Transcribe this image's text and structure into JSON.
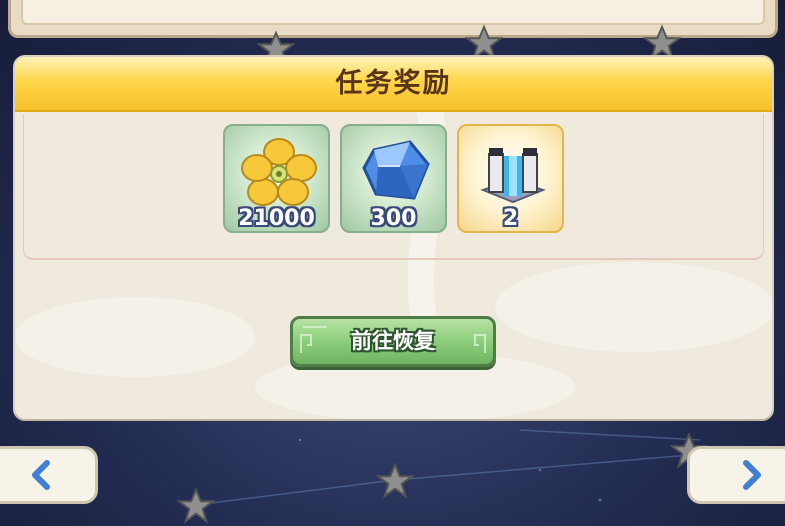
{
  "panel": {
    "title": "任务奖励",
    "rewards": [
      {
        "icon": "gold-flower-icon",
        "quantity": "21000"
      },
      {
        "icon": "blue-crystal-icon",
        "quantity": "300"
      },
      {
        "icon": "stone-gate-icon",
        "quantity": "2"
      }
    ],
    "go_button_label": "前往恢复"
  },
  "navigation": {
    "prev_icon": "chevron-left-icon",
    "next_icon": "chevron-right-icon"
  },
  "colors": {
    "header_yellow": "#ffd64a",
    "title_brown": "#5a3418",
    "button_green": "#8ccd7a",
    "background_navy": "#232c52",
    "arrow_blue": "#3f7fd6"
  }
}
